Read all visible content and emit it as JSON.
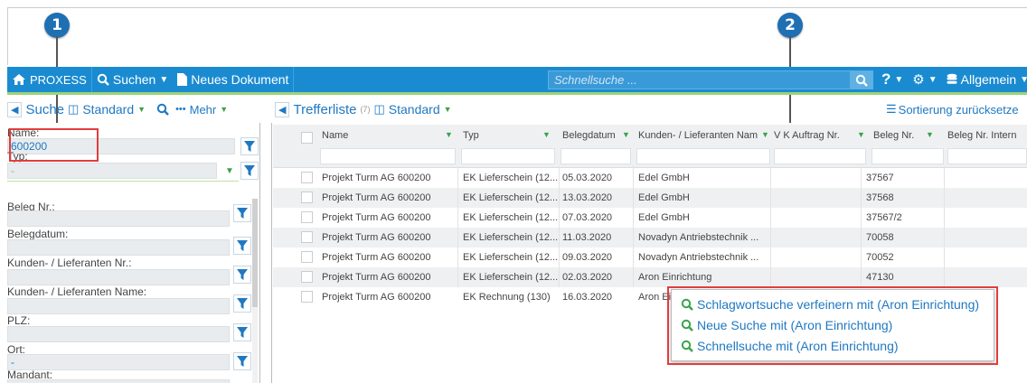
{
  "callouts": [
    "1",
    "2"
  ],
  "header": {
    "brand": "PROXESS",
    "search": "Suchen",
    "new_doc": "Neues Dokument",
    "quicksearch_placeholder": "Schnellsuche ...",
    "help": "?",
    "profile": "Allgemein"
  },
  "left_toolbar": {
    "title": "Suche",
    "view": "Standard",
    "more": "Mehr"
  },
  "right_toolbar": {
    "title": "Trefferliste",
    "count": "(7)",
    "view": "Standard",
    "reset_sort": "Sortierung zurücksetze"
  },
  "search_fields": [
    {
      "label": "Name:",
      "value": "600200"
    },
    {
      "label": "Typ:",
      "value": "-"
    },
    {
      "label": "Beleg Nr.:",
      "value": ""
    },
    {
      "label": "Belegdatum:",
      "value": ""
    },
    {
      "label": "Kunden- / Lieferanten Nr.:",
      "value": ""
    },
    {
      "label": "Kunden- / Lieferanten Name:",
      "value": ""
    },
    {
      "label": "PLZ:",
      "value": ""
    },
    {
      "label": "Ort:",
      "value": "-"
    },
    {
      "label": "Mandant:",
      "value": ""
    }
  ],
  "columns": [
    "Name",
    "Typ",
    "Belegdatum",
    "Kunden- / Lieferanten Nam",
    "V K Auftrag Nr.",
    "Beleg Nr.",
    "Beleg Nr. Intern"
  ],
  "rows": [
    [
      "Projekt Turm AG 600200",
      "EK Lieferschein (12...",
      "05.03.2020",
      "Edel GmbH",
      "",
      "37567"
    ],
    [
      "Projekt Turm AG 600200",
      "EK Lieferschein (12...",
      "13.03.2020",
      "Edel GmbH",
      "",
      "37568"
    ],
    [
      "Projekt Turm AG 600200",
      "EK Lieferschein (12...",
      "07.03.2020",
      "Edel GmbH",
      "",
      "37567/2"
    ],
    [
      "Projekt Turm AG 600200",
      "EK Lieferschein (12...",
      "11.03.2020",
      "Novadyn Antriebstechnik ...",
      "",
      "70058"
    ],
    [
      "Projekt Turm AG 600200",
      "EK Lieferschein (12...",
      "09.03.2020",
      "Novadyn Antriebstechnik ...",
      "",
      "70052"
    ],
    [
      "Projekt Turm AG 600200",
      "EK Lieferschein (12...",
      "02.03.2020",
      "Aron Einrichtung",
      "",
      "47130"
    ],
    [
      "Projekt Turm AG 600200",
      "EK Rechnung (130)",
      "16.03.2020",
      "Aron Ei",
      "",
      ""
    ]
  ],
  "context_menu": [
    "Schlagwortsuche verfeinern mit (Aron Einrichtung)",
    "Neue Suche mit (Aron Einrichtung)",
    "Schnellsuche mit (Aron Einrichtung)"
  ],
  "colors": {
    "topbar": "#1a8bd1",
    "accent": "#1f78c1",
    "highlight": "#e23d3d",
    "callout": "#1f6fb3"
  }
}
